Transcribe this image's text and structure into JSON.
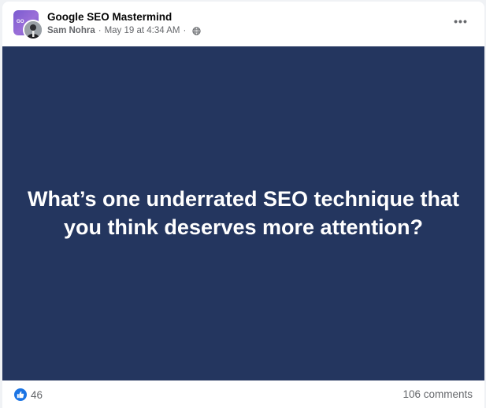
{
  "post": {
    "group_name": "Google SEO Mastermind",
    "group_avatar_text": "GO",
    "author": "Sam Nohra",
    "separator": "·",
    "timestamp": "May 19 at 4:34 AM",
    "privacy_icon": "globe-icon",
    "more_icon": "more-options-icon",
    "more_label": "•••",
    "image_text": "What’s one underrated SEO technique that you think deserves more attention?",
    "image_background": "#24365f",
    "reaction_icon": "like-icon",
    "reaction_count": "46",
    "comments_label": "106 comments",
    "accent_color": "#1b74e4"
  }
}
